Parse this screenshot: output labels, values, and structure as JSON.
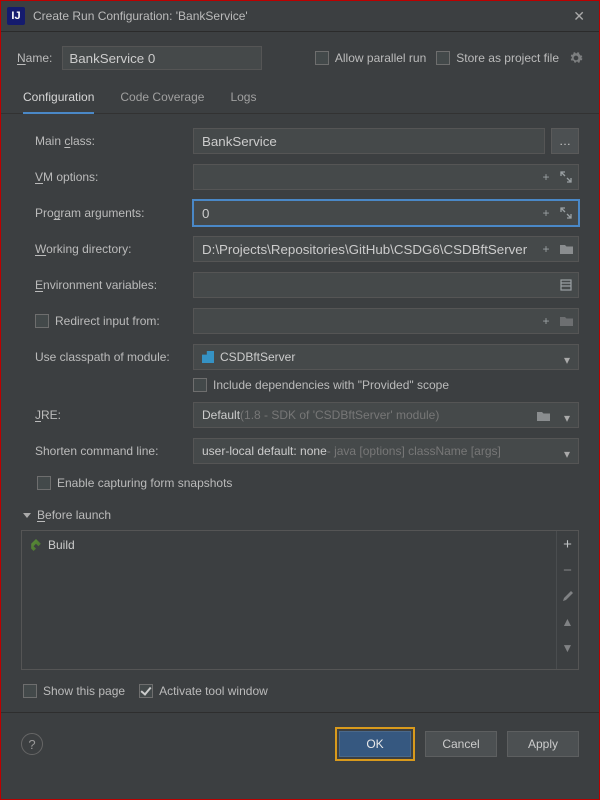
{
  "titlebar": {
    "title": "Create Run Configuration: 'BankService'"
  },
  "top": {
    "name_label": "Name:",
    "name_value": "BankService 0",
    "allow_parallel": "Allow parallel run",
    "store_project": "Store as project file"
  },
  "tabs": {
    "configuration": "Configuration",
    "coverage": "Code Coverage",
    "logs": "Logs"
  },
  "fields": {
    "main_class_label": "Main class:",
    "main_class_value": "BankService",
    "vm_options_label": "VM options:",
    "vm_options_value": "",
    "program_args_label": "Program arguments:",
    "program_args_value": "0",
    "working_dir_label": "Working directory:",
    "working_dir_value": "D:\\Projects\\Repositories\\GitHub\\CSDG6\\CSDBftServer",
    "env_vars_label": "Environment variables:",
    "env_vars_value": "",
    "redirect_label": "Redirect input from:",
    "redirect_value": "",
    "classpath_label": "Use classpath of module:",
    "classpath_value": "CSDBftServer",
    "include_deps": "Include dependencies with \"Provided\" scope",
    "jre_label": "JRE:",
    "jre_value": "Default ",
    "jre_hint": "(1.8 - SDK of 'CSDBftServer' module)",
    "shorten_label": "Shorten command line:",
    "shorten_value": "user-local default: none ",
    "shorten_hint": "- java [options] className [args]",
    "enable_snapshots": "Enable capturing form snapshots"
  },
  "before_launch": {
    "header": "Before launch",
    "build": "Build"
  },
  "bottom": {
    "show_page": "Show this page",
    "activate_tool": "Activate tool window"
  },
  "footer": {
    "ok": "OK",
    "cancel": "Cancel",
    "apply": "Apply"
  }
}
